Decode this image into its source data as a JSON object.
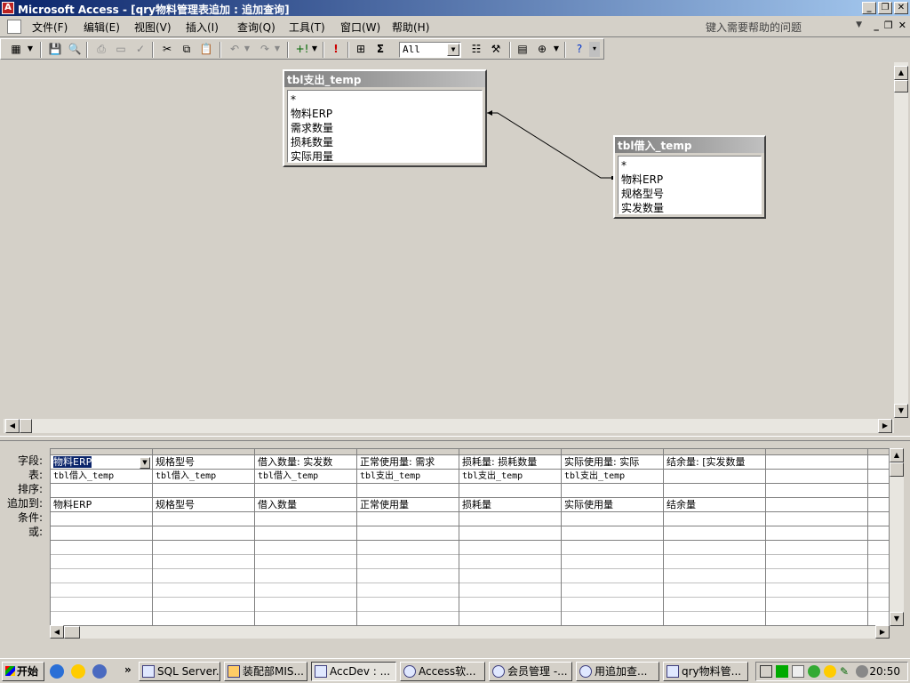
{
  "window": {
    "title": "Microsoft Access - [qry物料管理表追加 : 追加查询]",
    "icon": "access-key-icon"
  },
  "menu": {
    "items": [
      "文件(F)",
      "编辑(E)",
      "视图(V)",
      "插入(I)",
      "查询(Q)",
      "工具(T)",
      "窗口(W)",
      "帮助(H)"
    ],
    "help_placeholder": "键入需要帮助的问题"
  },
  "toolbar": {
    "top_values": "All"
  },
  "tables": [
    {
      "name": "tbl支出_temp",
      "fields": [
        "*",
        "物料ERP",
        "需求数量",
        "损耗数量",
        "实际用量"
      ]
    },
    {
      "name": "tbl借入_temp",
      "fields": [
        "*",
        "物料ERP",
        "规格型号",
        "实发数量"
      ]
    }
  ],
  "grid": {
    "row_labels": [
      "字段:",
      "表:",
      "排序:",
      "追加到:",
      "条件:",
      "或:"
    ],
    "columns": [
      {
        "field": "物料ERP",
        "table": "tbl借入_temp",
        "append_to": "物料ERP"
      },
      {
        "field": "规格型号",
        "table": "tbl借入_temp",
        "append_to": "规格型号"
      },
      {
        "field": "借入数量: 实发数",
        "table": "tbl借入_temp",
        "append_to": "借入数量"
      },
      {
        "field": "正常使用量: 需求",
        "table": "tbl支出_temp",
        "append_to": "正常使用量"
      },
      {
        "field": "损耗量: 损耗数量",
        "table": "tbl支出_temp",
        "append_to": "损耗量"
      },
      {
        "field": "实际使用量: 实际",
        "table": "tbl支出_temp",
        "append_to": "实际使用量"
      },
      {
        "field": "结余量: [实发数量",
        "table": "",
        "append_to": "结余量"
      },
      {
        "field": "",
        "table": "",
        "append_to": ""
      },
      {
        "field": "",
        "table": "",
        "append_to": ""
      }
    ]
  },
  "taskbar": {
    "start": "开始",
    "tasks": [
      "SQL Server...",
      "装配部MIS...",
      "AccDev : ...",
      "Access软...",
      "会员管理 -...",
      "用追加查...",
      "qry物料管..."
    ],
    "clock": "20:50"
  }
}
